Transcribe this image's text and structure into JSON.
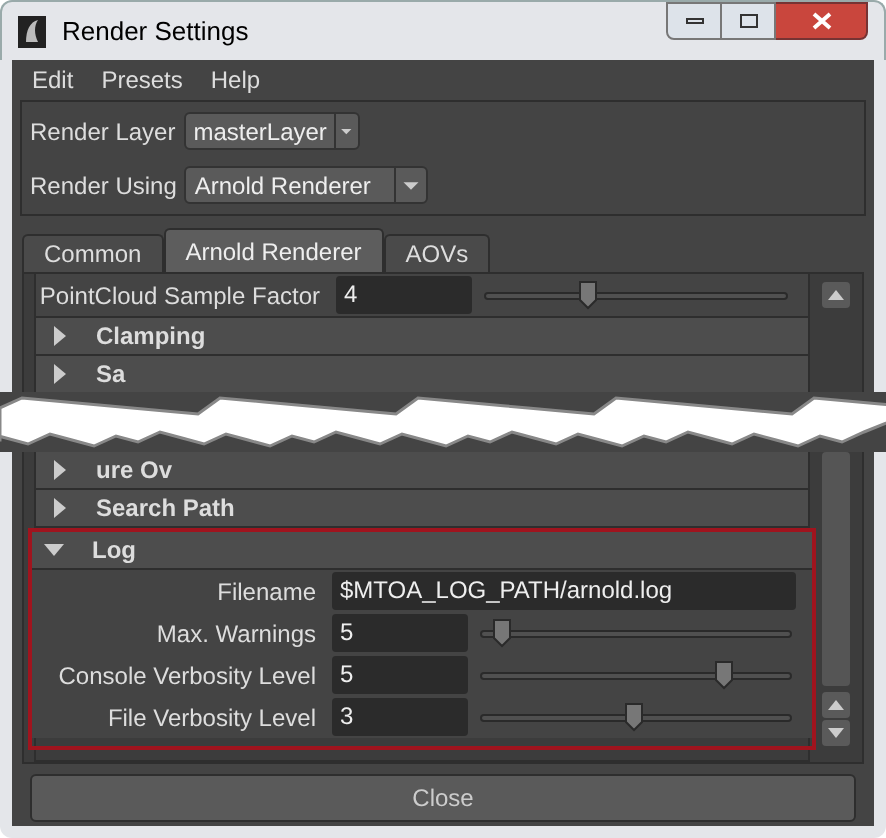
{
  "window": {
    "title": "Render Settings"
  },
  "menu": [
    "Edit",
    "Presets",
    "Help"
  ],
  "selectors": [
    {
      "label": "Render Layer",
      "value": "masterLayer"
    },
    {
      "label": "Render Using",
      "value": "Arnold Renderer"
    }
  ],
  "tabs": [
    {
      "label": "Common",
      "selected": false
    },
    {
      "label": "Arnold Renderer",
      "selected": true
    },
    {
      "label": "AOVs",
      "selected": false
    }
  ],
  "top_rows": [
    {
      "kind": "slider",
      "label": "PointCloud Sample Factor",
      "value": "4",
      "level": 0.33
    },
    {
      "kind": "section",
      "label": "Clamping",
      "expanded": false
    },
    {
      "kind": "section",
      "label": "Sa",
      "expanded": false
    }
  ],
  "bottom_rows": [
    {
      "kind": "section",
      "label": "ure Ov",
      "expanded": false
    },
    {
      "kind": "section",
      "label": "Search Path",
      "expanded": false
    }
  ],
  "log": {
    "label": "Log",
    "expanded": true,
    "fields": [
      {
        "kind": "text",
        "label": "Filename",
        "value": "$MTOA_LOG_PATH/arnold.log"
      },
      {
        "kind": "slider",
        "label": "Max. Warnings",
        "value": "5",
        "level": 0.04
      },
      {
        "kind": "slider",
        "label": "Console Verbosity Level",
        "value": "5",
        "level": 0.8
      },
      {
        "kind": "slider",
        "label": "File Verbosity Level",
        "value": "3",
        "level": 0.49
      }
    ]
  },
  "close_button": "Close"
}
